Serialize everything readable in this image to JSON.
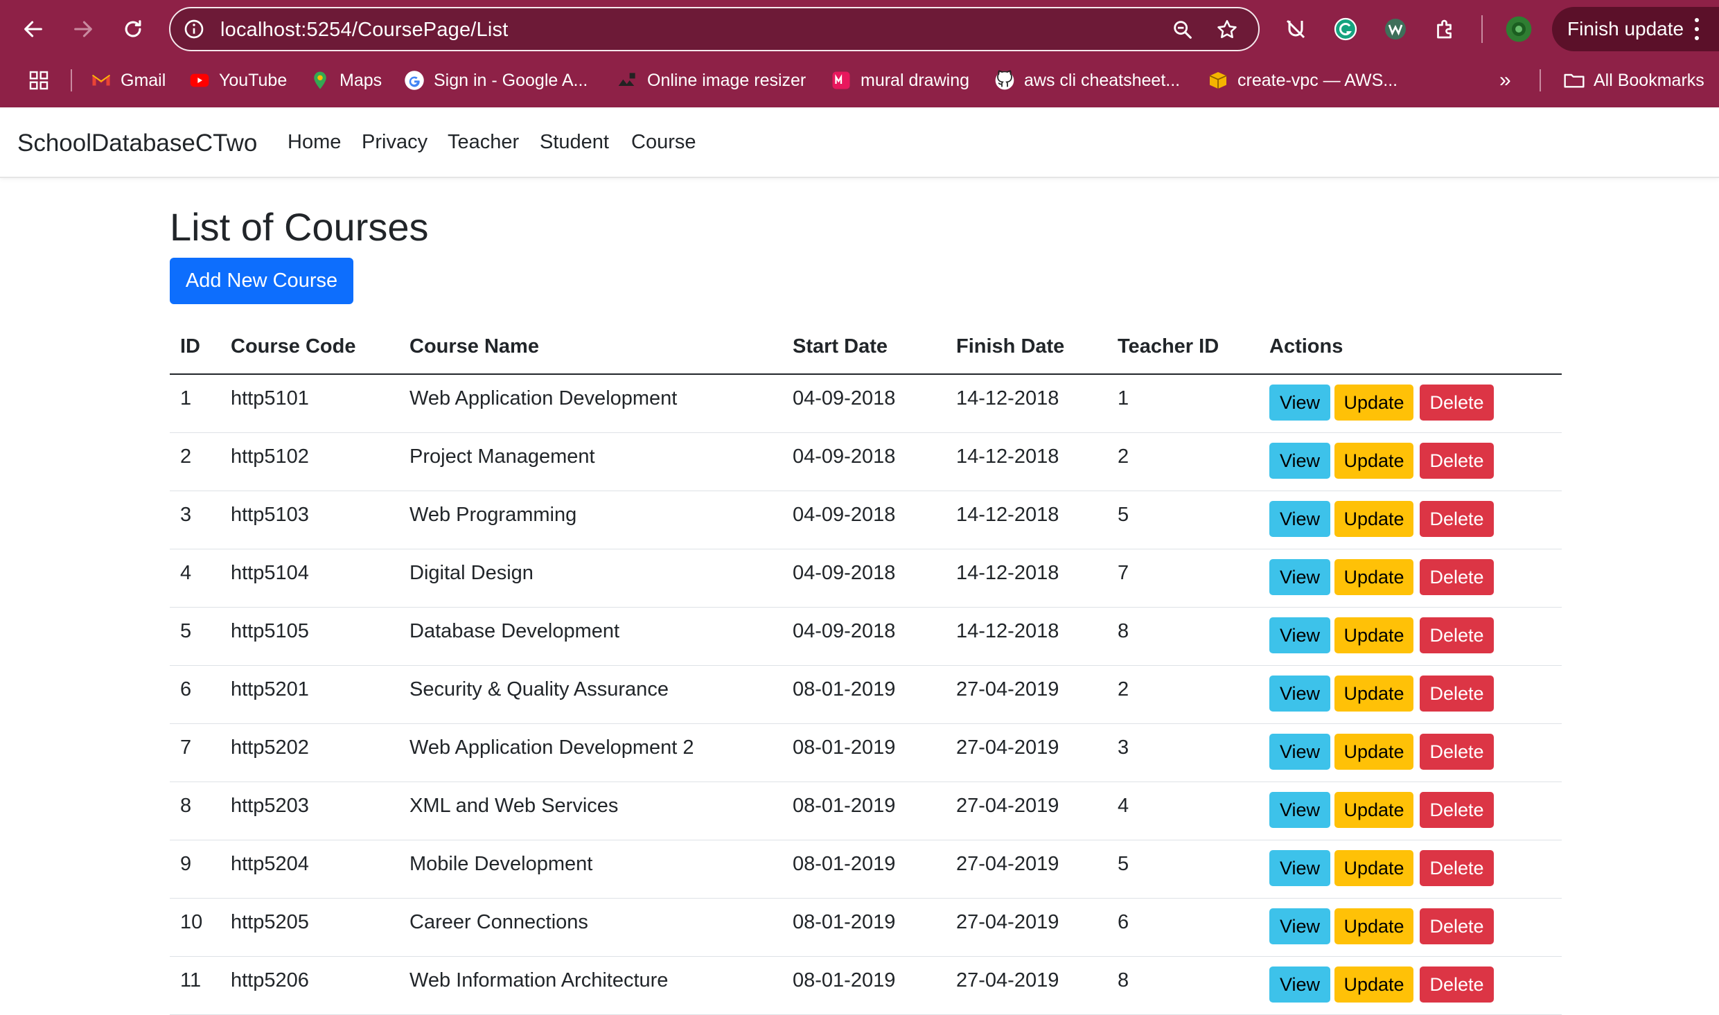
{
  "browser": {
    "url": "localhost:5254/CoursePage/List",
    "finish_update_label": "Finish update",
    "bookmarks": [
      {
        "label": "Gmail",
        "icon": "gmail-icon"
      },
      {
        "label": "YouTube",
        "icon": "youtube-icon"
      },
      {
        "label": "Maps",
        "icon": "maps-icon"
      },
      {
        "label": "Sign in - Google A...",
        "icon": "google-icon"
      },
      {
        "label": "Online image resizer",
        "icon": "image-resizer-icon"
      },
      {
        "label": "mural drawing",
        "icon": "mural-icon"
      },
      {
        "label": "aws cli cheatsheet...",
        "icon": "github-icon"
      },
      {
        "label": "create-vpc — AWS...",
        "icon": "aws-icon"
      }
    ],
    "all_bookmarks_label": "All Bookmarks",
    "overflow_label": "»"
  },
  "app_nav": {
    "brand": "SchoolDatabaseCTwo",
    "links": [
      "Home",
      "Privacy",
      "Teacher",
      "Student",
      "Course"
    ]
  },
  "main": {
    "title": "List of Courses",
    "add_button_label": "Add New Course"
  },
  "table": {
    "headers": [
      "ID",
      "Course Code",
      "Course Name",
      "Start Date",
      "Finish Date",
      "Teacher ID",
      "Actions"
    ],
    "action_labels": {
      "view": "View",
      "update": "Update",
      "delete": "Delete"
    },
    "rows": [
      {
        "id": "1",
        "code": "http5101",
        "name": "Web Application Development",
        "start": "04-09-2018",
        "finish": "14-12-2018",
        "teacher": "1"
      },
      {
        "id": "2",
        "code": "http5102",
        "name": "Project Management",
        "start": "04-09-2018",
        "finish": "14-12-2018",
        "teacher": "2"
      },
      {
        "id": "3",
        "code": "http5103",
        "name": "Web Programming",
        "start": "04-09-2018",
        "finish": "14-12-2018",
        "teacher": "5"
      },
      {
        "id": "4",
        "code": "http5104",
        "name": "Digital Design",
        "start": "04-09-2018",
        "finish": "14-12-2018",
        "teacher": "7"
      },
      {
        "id": "5",
        "code": "http5105",
        "name": "Database Development",
        "start": "04-09-2018",
        "finish": "14-12-2018",
        "teacher": "8"
      },
      {
        "id": "6",
        "code": "http5201",
        "name": "Security & Quality Assurance",
        "start": "08-01-2019",
        "finish": "27-04-2019",
        "teacher": "2"
      },
      {
        "id": "7",
        "code": "http5202",
        "name": "Web Application Development 2",
        "start": "08-01-2019",
        "finish": "27-04-2019",
        "teacher": "3"
      },
      {
        "id": "8",
        "code": "http5203",
        "name": "XML and Web Services",
        "start": "08-01-2019",
        "finish": "27-04-2019",
        "teacher": "4"
      },
      {
        "id": "9",
        "code": "http5204",
        "name": "Mobile Development",
        "start": "08-01-2019",
        "finish": "27-04-2019",
        "teacher": "5"
      },
      {
        "id": "10",
        "code": "http5205",
        "name": "Career Connections",
        "start": "08-01-2019",
        "finish": "27-04-2019",
        "teacher": "6"
      },
      {
        "id": "11",
        "code": "http5206",
        "name": "Web Information Architecture",
        "start": "08-01-2019",
        "finish": "27-04-2019",
        "teacher": "8"
      }
    ]
  },
  "colors": {
    "chrome_bg": "#8e2147",
    "primary": "#0d6efd",
    "info": "#3dc2ea",
    "warning": "#ffc107",
    "danger": "#dc3545"
  }
}
